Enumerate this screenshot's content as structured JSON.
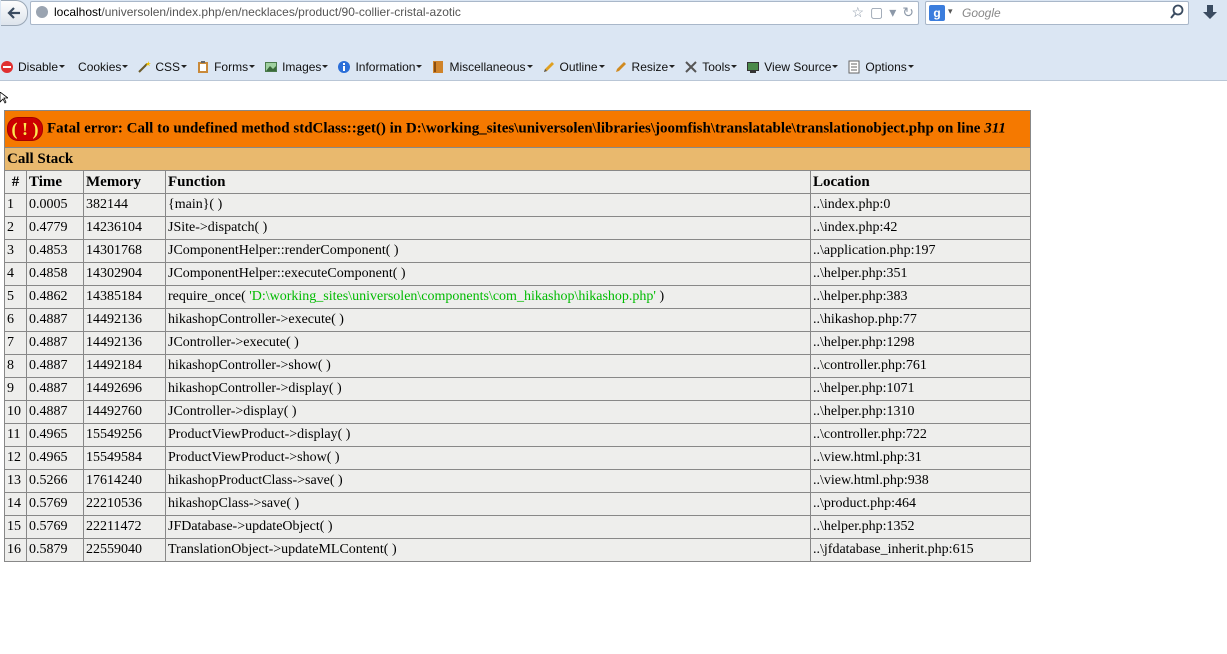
{
  "browser": {
    "url_host": "localhost",
    "url_path": "/universolen/index.php/en/necklaces/product/90-collier-cristal-azotic",
    "search_placeholder": "Google"
  },
  "toolbar": {
    "items": [
      {
        "label": "Disable",
        "icon": "no-entry-icon"
      },
      {
        "label": "Cookies",
        "icon": "cookie-icon"
      },
      {
        "label": "CSS",
        "icon": "wand-icon"
      },
      {
        "label": "Forms",
        "icon": "clipboard-icon"
      },
      {
        "label": "Images",
        "icon": "image-icon"
      },
      {
        "label": "Information",
        "icon": "info-icon"
      },
      {
        "label": "Miscellaneous",
        "icon": "book-icon"
      },
      {
        "label": "Outline",
        "icon": "pencil-icon"
      },
      {
        "label": "Resize",
        "icon": "resize-icon"
      },
      {
        "label": "Tools",
        "icon": "tools-icon"
      },
      {
        "label": "View Source",
        "icon": "monitor-icon"
      },
      {
        "label": "Options",
        "icon": "list-icon"
      }
    ]
  },
  "error": {
    "icon_text": "( ! )",
    "message": "Fatal error: Call to undefined method stdClass::get() in D:\\working_sites\\universolen\\libraries\\joomfish\\translatable\\translationobject.php on line ",
    "line": "311",
    "call_stack_title": "Call Stack",
    "headers": [
      "#",
      "Time",
      "Memory",
      "Function",
      "Location"
    ],
    "rows": [
      {
        "n": "1",
        "time": "0.0005",
        "memory": "382144",
        "func": "{main}( )",
        "arg": "",
        "func_end": "",
        "location": "..\\index.php:0"
      },
      {
        "n": "2",
        "time": "0.4779",
        "memory": "14236104",
        "func": "JSite->dispatch( )",
        "arg": "",
        "func_end": "",
        "location": "..\\index.php:42"
      },
      {
        "n": "3",
        "time": "0.4853",
        "memory": "14301768",
        "func": "JComponentHelper::renderComponent( )",
        "arg": "",
        "func_end": "",
        "location": "..\\application.php:197"
      },
      {
        "n": "4",
        "time": "0.4858",
        "memory": "14302904",
        "func": "JComponentHelper::executeComponent( )",
        "arg": "",
        "func_end": "",
        "location": "..\\helper.php:351"
      },
      {
        "n": "5",
        "time": "0.4862",
        "memory": "14385184",
        "func": "require_once( ",
        "arg": "'D:\\working_sites\\universolen\\components\\com_hikashop\\hikashop.php'",
        "func_end": " )",
        "location": "..\\helper.php:383"
      },
      {
        "n": "6",
        "time": "0.4887",
        "memory": "14492136",
        "func": "hikashopController->execute( )",
        "arg": "",
        "func_end": "",
        "location": "..\\hikashop.php:77"
      },
      {
        "n": "7",
        "time": "0.4887",
        "memory": "14492136",
        "func": "JController->execute( )",
        "arg": "",
        "func_end": "",
        "location": "..\\helper.php:1298"
      },
      {
        "n": "8",
        "time": "0.4887",
        "memory": "14492184",
        "func": "hikashopController->show( )",
        "arg": "",
        "func_end": "",
        "location": "..\\controller.php:761"
      },
      {
        "n": "9",
        "time": "0.4887",
        "memory": "14492696",
        "func": "hikashopController->display( )",
        "arg": "",
        "func_end": "",
        "location": "..\\helper.php:1071"
      },
      {
        "n": "10",
        "time": "0.4887",
        "memory": "14492760",
        "func": "JController->display( )",
        "arg": "",
        "func_end": "",
        "location": "..\\helper.php:1310"
      },
      {
        "n": "11",
        "time": "0.4965",
        "memory": "15549256",
        "func": "ProductViewProduct->display( )",
        "arg": "",
        "func_end": "",
        "location": "..\\controller.php:722"
      },
      {
        "n": "12",
        "time": "0.4965",
        "memory": "15549584",
        "func": "ProductViewProduct->show( )",
        "arg": "",
        "func_end": "",
        "location": "..\\view.html.php:31"
      },
      {
        "n": "13",
        "time": "0.5266",
        "memory": "17614240",
        "func": "hikashopProductClass->save( )",
        "arg": "",
        "func_end": "",
        "location": "..\\view.html.php:938"
      },
      {
        "n": "14",
        "time": "0.5769",
        "memory": "22210536",
        "func": "hikashopClass->save( )",
        "arg": "",
        "func_end": "",
        "location": "..\\product.php:464"
      },
      {
        "n": "15",
        "time": "0.5769",
        "memory": "22211472",
        "func": "JFDatabase->updateObject( )",
        "arg": "",
        "func_end": "",
        "location": "..\\helper.php:1352"
      },
      {
        "n": "16",
        "time": "0.5879",
        "memory": "22559040",
        "func": "TranslationObject->updateMLContent( )",
        "arg": "",
        "func_end": "",
        "location": "..\\jfdatabase_inherit.php:615"
      }
    ]
  }
}
